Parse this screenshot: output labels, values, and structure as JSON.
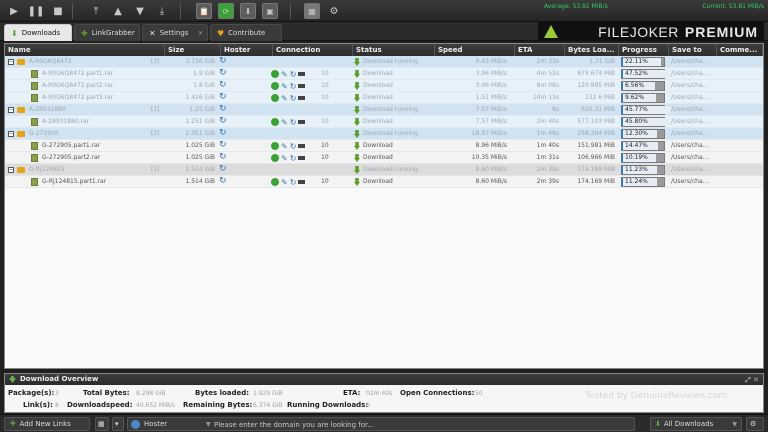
{
  "toolbar": {
    "buttons": [
      "play-icon",
      "pause-icon",
      "stop-icon",
      "move-top-icon",
      "move-up-icon",
      "move-down-icon",
      "move-bottom-icon",
      "clipboard-icon",
      "reconnect-icon",
      "update-icon",
      "screenshot-icon",
      "premium-icon",
      "settings-icon"
    ],
    "average_speed": "Average: 53.81 MiB/s",
    "current_speed": "Current: 53.81 MiB/s"
  },
  "tabs": [
    {
      "label": "Downloads",
      "active": true
    },
    {
      "label": "LinkGrabber",
      "active": false
    },
    {
      "label": "Settings",
      "active": false
    },
    {
      "label": "Contribute",
      "active": false
    }
  ],
  "logo": {
    "part1": "FILEJOKER",
    "part2": "PREMIUM"
  },
  "table": {
    "headers": [
      "Name",
      "Size",
      "Hoster",
      "Connection",
      "Status",
      "Speed",
      "ETA",
      "Bytes Loa...",
      "Progress",
      "Save to",
      "Comme..."
    ],
    "rows": [
      {
        "kind": "pkg",
        "name": "A-R0G6Q8472",
        "count": "[3]",
        "size": "3.736 GiB",
        "connections": "",
        "status": "Download running",
        "speed": "9.43 MiB/s",
        "eta": "2m 33s",
        "bytes": "1.71 GiB",
        "progress": 22.11,
        "progress_text": "22.11%",
        "save_to": "/Users/cha..."
      },
      {
        "kind": "child",
        "name": "A-R0G6Q8472.part1.rar",
        "size": "1.9 GiB",
        "connections": "10",
        "status": "Download",
        "speed": "3.96 MiB/s",
        "eta": "4m 52s",
        "bytes": "875.674 MiB",
        "progress": 47.52,
        "progress_text": "47.52%",
        "save_to": "/Users/cha..."
      },
      {
        "kind": "child",
        "name": "A-R0G6Q8472.part2.rar",
        "size": "1.8 GiB",
        "connections": "10",
        "status": "Download",
        "speed": "3.96 MiB/s",
        "eta": "8m 08s",
        "bytes": "120.885 MiB",
        "progress": 6.56,
        "progress_text": "6.56%",
        "save_to": "/Users/cha..."
      },
      {
        "kind": "child",
        "name": "A-R0G6Q8472.part3.rar",
        "size": "1.416 GiB",
        "connections": "10",
        "status": "Download",
        "speed": "1.51 MiB/s",
        "eta": "14m 13s",
        "bytes": "132.6 MiB",
        "progress": 9.62,
        "progress_text": "9.62%",
        "save_to": "/Users/cha..."
      },
      {
        "kind": "pkg",
        "name": "A-28931880",
        "count": "[1]",
        "size": "1.25 GiB",
        "connections": "",
        "status": "Download running",
        "speed": "7.57 MiB/s",
        "eta": "9s",
        "bytes": "626.31 MiB",
        "progress": 45.77,
        "progress_text": "45.77%",
        "save_to": "/Users/cha..."
      },
      {
        "kind": "child",
        "name": "A-28931880.rar",
        "size": "1.251 GiB",
        "connections": "10",
        "status": "Download",
        "speed": "7.57 MiB/s",
        "eta": "2m 40s",
        "bytes": "577.103 MiB",
        "progress": 45.8,
        "progress_text": "45.80%",
        "save_to": "/Users/cha..."
      },
      {
        "kind": "pkg",
        "name": "G-272905",
        "count": "[2]",
        "size": "2.051 GiB",
        "connections": "",
        "status": "Download running",
        "speed": "18.97 MiB/s",
        "eta": "1m 49s",
        "bytes": "258.384 MiB",
        "progress": 12.3,
        "progress_text": "12.30%",
        "save_to": "/Users/cha..."
      },
      {
        "kind": "child-white",
        "name": "G-272905.part1.rar",
        "size": "1.025 GiB",
        "connections": "10",
        "status": "Download",
        "speed": "8.96 MiB/s",
        "eta": "1m 40s",
        "bytes": "151.981 MiB",
        "progress": 14.47,
        "progress_text": "14.47%",
        "save_to": "/Users/cha..."
      },
      {
        "kind": "child-white",
        "name": "G-272905.part2.rar",
        "size": "1.025 GiB",
        "connections": "10",
        "status": "Download",
        "speed": "10.35 MiB/s",
        "eta": "1m 31s",
        "bytes": "106.966 MiB",
        "progress": 10.19,
        "progress_text": "10.19%",
        "save_to": "/Users/cha..."
      },
      {
        "kind": "pkg-grey",
        "name": "G-RJ124815",
        "count": "[1]",
        "size": "1.514 GiB",
        "connections": "",
        "status": "Download running",
        "speed": "8.60 MiB/s",
        "eta": "2m 39s",
        "bytes": "174.169 MiB",
        "progress": 11.23,
        "progress_text": "11.23%",
        "save_to": "/Users/cha..."
      },
      {
        "kind": "child-white",
        "name": "G-RJ124815.part1.rar",
        "size": "1.514 GiB",
        "connections": "10",
        "status": "Download",
        "speed": "8.60 MiB/s",
        "eta": "2m 39s",
        "bytes": "174.169 MiB",
        "progress": 11.24,
        "progress_text": "11.24%",
        "save_to": "/Users/cha..."
      }
    ]
  },
  "overview": {
    "title": "Download Overview",
    "packages_label": "Package(s):",
    "packages": "3",
    "total_bytes_label": "Total Bytes:",
    "total_bytes": "8.298 GiB",
    "bytes_loaded_label": "Bytes loaded:",
    "bytes_loaded": "1.929 GiB",
    "eta_label": "ETA:",
    "eta": "02m:40s",
    "open_conn_label": "Open Connections:",
    "open_conn": "50",
    "links_label": "Link(s):",
    "links": "8",
    "dlspeed_label": "Downloadspeed:",
    "dlspeed": "40.652 MiB/s",
    "remaining_label": "Remaining Bytes:",
    "remaining": "6.374 GiB",
    "running_label": "Running Downloads:",
    "running": "6",
    "watermark": "Tested by GenuineReviews.com"
  },
  "bottombar": {
    "add_links": "Add New Links",
    "hoster_select": "Hoster",
    "search_placeholder": "Please enter the domain you are looking for...",
    "all_downloads": "All Downloads"
  },
  "colors": {
    "accent_green": "#6db33f",
    "progress_marker": "#3a7abf",
    "row_selected": "#cfe3f3"
  }
}
